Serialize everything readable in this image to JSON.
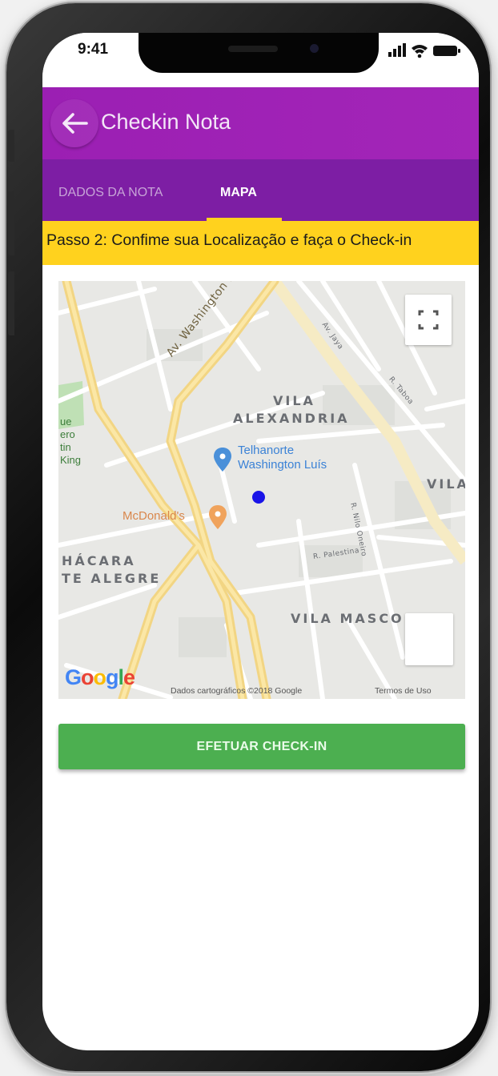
{
  "status_bar": {
    "time": "9:41"
  },
  "app_bar": {
    "title": "Checkin Nota",
    "back_icon": "arrow-left-icon"
  },
  "tabs": [
    {
      "label": "DADOS DA NOTA",
      "active": false
    },
    {
      "label": "MAPA",
      "active": true
    }
  ],
  "step_banner": {
    "text": "Passo 2: Confime sua Localização e faça o Check-in"
  },
  "map": {
    "neighborhoods": [
      "VILA",
      "ALEXANDRIA",
      "VILA",
      "HÁCARA",
      "TE ALEGRE",
      "VILA MASCO"
    ],
    "streets": [
      "Av. Washington Luís",
      "R. Palestina",
      "R. Nilo Oneiro",
      "Av. Jaya",
      "R. Taboa"
    ],
    "poi_telhanorte": [
      "Telhanorte",
      "Washington Luís"
    ],
    "poi_mcdonalds": "McDonald's",
    "park_text": [
      "ue",
      "ero",
      "tin",
      "King"
    ],
    "google_logo": [
      "G",
      "o",
      "o",
      "g",
      "l",
      "e"
    ],
    "attribution": "Dados cartográficos ©2018 Google",
    "terms": "Termos de Uso"
  },
  "checkin_button": {
    "label": "EFETUAR CHECK-IN"
  },
  "colors": {
    "app_bar": "#a325b8",
    "tab_bar": "#7d1ea4",
    "banner": "#ffd21e",
    "button": "#4caf50",
    "location_dot": "#1a14e8"
  }
}
